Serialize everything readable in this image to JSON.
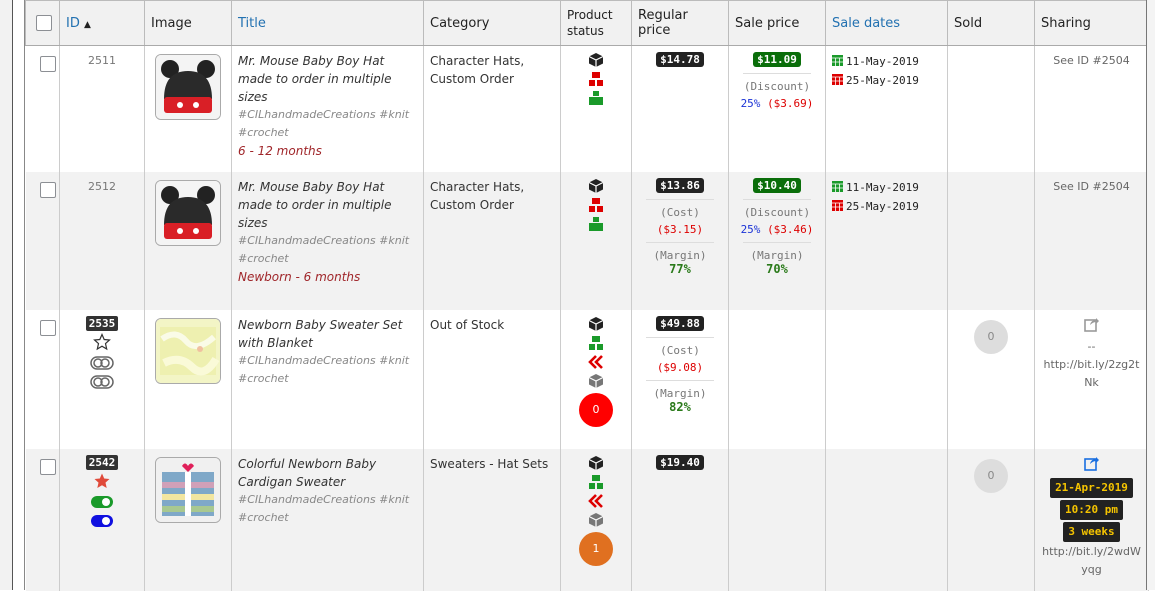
{
  "headers": {
    "id": "ID",
    "image": "Image",
    "title": "Title",
    "category": "Category",
    "status_line1": "Product",
    "status_line2": "status",
    "regular": "Regular price",
    "sale": "Sale price",
    "sale_dates": "Sale dates",
    "sold": "Sold",
    "sharing": "Sharing"
  },
  "rows": [
    {
      "id": "2511",
      "title": "Mr. Mouse Baby Boy Hat made to order in multiple sizes",
      "tags": "#CILhandmadeCreations #knit #crochet",
      "variant": "6 - 12 months",
      "category": "Character Hats, Custom Order",
      "regular": "$14.78",
      "sale": "$11.09",
      "discount_label": "(Discount)",
      "discount_pct": "25%",
      "discount_amt": "($3.69)",
      "date_from": "11-May-2019",
      "date_to": "25-May-2019",
      "sharing": "See ID #2504"
    },
    {
      "id": "2512",
      "title": "Mr. Mouse Baby Boy Hat made to order in multiple sizes",
      "tags": "#CILhandmadeCreations #knit #crochet",
      "variant": "Newborn - 6 months",
      "category": "Character Hats, Custom Order",
      "regular": "$13.86",
      "cost_label": "(Cost)",
      "cost": "($3.15)",
      "margin_label": "(Margin)",
      "margin": "77%",
      "sale": "$10.40",
      "discount_label": "(Discount)",
      "discount_pct": "25%",
      "discount_amt": "($3.46)",
      "sale_margin_label": "(Margin)",
      "sale_margin": "70%",
      "date_from": "11-May-2019",
      "date_to": "25-May-2019",
      "sharing": "See ID #2504"
    },
    {
      "id": "2535",
      "title": "Newborn Baby Sweater Set with Blanket",
      "tags": "#CILhandmadeCreations #knit #crochet",
      "category": "Out of Stock",
      "status_count": "0",
      "regular": "$49.88",
      "cost_label": "(Cost)",
      "cost": "($9.08)",
      "margin_label": "(Margin)",
      "margin": "82%",
      "sold": "0",
      "share_dash": "--",
      "share_url": "http://bit.ly/2zg2tNk"
    },
    {
      "id": "2542",
      "title": "Colorful Newborn Baby Cardigan Sweater",
      "tags": "#CILhandmadeCreations #knit #crochet",
      "category": "Sweaters - Hat Sets",
      "status_count": "1",
      "regular": "$19.40",
      "sold": "0",
      "share_date": "21-Apr-2019",
      "share_time": "10:20 pm",
      "share_ago": "3 weeks",
      "share_url": "http://bit.ly/2wdWyqg"
    }
  ],
  "colors": {
    "accent": "#2271b1",
    "sale_green": "#0a6e0a",
    "status_red": "#ff0000",
    "status_orange": "#e07020"
  }
}
